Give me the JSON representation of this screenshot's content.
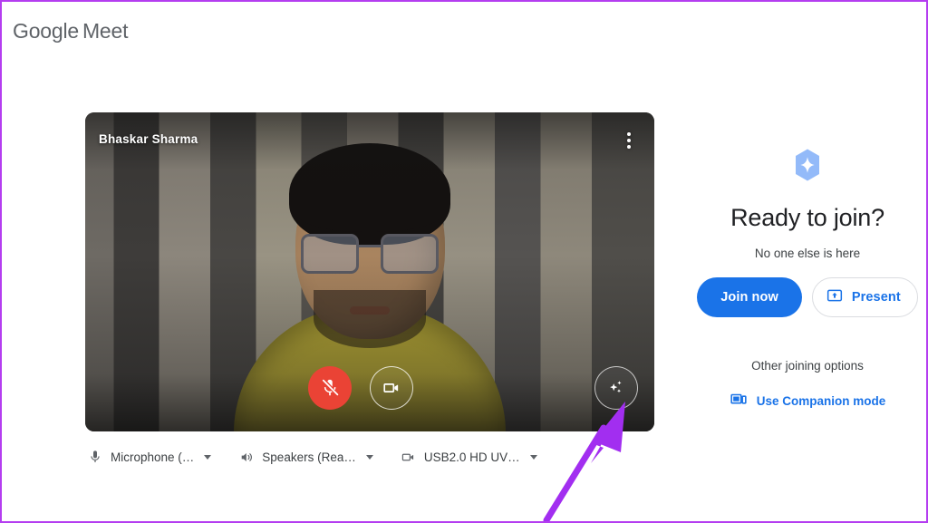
{
  "brand": {
    "google": "Google",
    "product": "Meet"
  },
  "preview": {
    "participant_name": "Bhaskar Sharma",
    "menu_icon": "more-vert-icon",
    "controls": [
      {
        "name": "microphone-toggle",
        "icon": "mic-off-icon",
        "state": "muted",
        "color": "#ea4335"
      },
      {
        "name": "camera-toggle",
        "icon": "videocam-icon",
        "state": "on",
        "color": "#ffffff"
      },
      {
        "name": "visual-effects",
        "icon": "sparkle-icon",
        "state": "off",
        "color": "#ffffff"
      }
    ]
  },
  "devices": [
    {
      "icon": "microphone-icon",
      "label": "Microphone (…"
    },
    {
      "icon": "speaker-icon",
      "label": "Speakers (Rea…"
    },
    {
      "icon": "camera-icon",
      "label": "USB2.0 HD UV…"
    }
  ],
  "join_panel": {
    "badge_icon": "gemini-sparkle-icon",
    "title": "Ready to join?",
    "subtitle": "No one else is here",
    "join_button": "Join now",
    "present_button": "Present",
    "present_icon": "present-screen-icon",
    "other_options": "Other joining options",
    "companion_label": "Use Companion mode",
    "companion_icon": "companion-device-icon"
  },
  "colors": {
    "frame_border": "#b43df0",
    "annotation_arrow": "#a22ef0",
    "primary_blue": "#1a73e8",
    "mute_red": "#ea4335",
    "text_primary": "#202124",
    "text_secondary": "#3c4043",
    "icon_grey": "#5f6368"
  }
}
